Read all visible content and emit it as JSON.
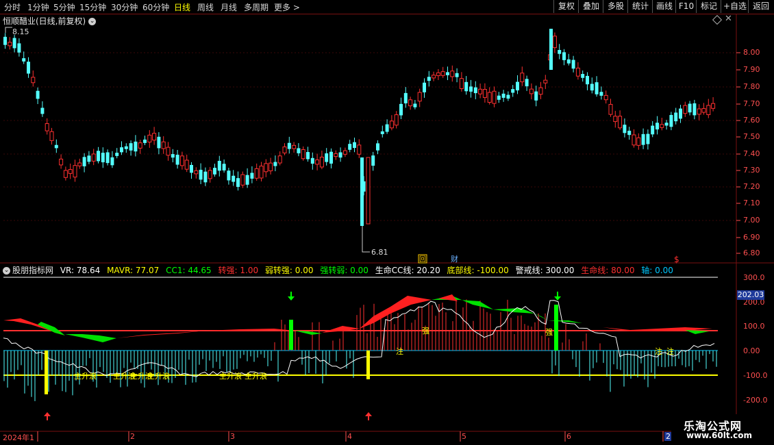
{
  "toolbar": {
    "timeframes": [
      "分时",
      "1分钟",
      "5分钟",
      "15分钟",
      "30分钟",
      "60分钟",
      "日线",
      "周线",
      "月线",
      "多周期",
      "更多 >"
    ],
    "active_timeframe": "日线",
    "right_buttons": [
      "复权",
      "叠加",
      "多股",
      "统计",
      "画线",
      "F10",
      "标记",
      "+自选",
      "返回"
    ]
  },
  "chart_title": "恒顺醋业(日线,前复权)",
  "price_axis": [
    "8.00",
    "7.90",
    "7.80",
    "7.70",
    "7.60",
    "7.50",
    "7.40",
    "7.30",
    "7.20",
    "7.10",
    "7.00",
    "6.90",
    "6.80"
  ],
  "high_label": "8.15",
  "low_label": "6.81",
  "markers": {
    "hui": "回",
    "cai": "财",
    "dollar": "$"
  },
  "indicator": {
    "name": "股朋指标网",
    "items": [
      {
        "text": "VR: 78.64",
        "color": "#ffffff"
      },
      {
        "text": "MAVR: 77.07",
        "color": "#ffff00"
      },
      {
        "text": "CC1: 44.65",
        "color": "#00ff00"
      },
      {
        "text": "转强: 1.00",
        "color": "#ff3030"
      },
      {
        "text": "弱转强: 0.00",
        "color": "#ffff00"
      },
      {
        "text": "强转弱: 0.00",
        "color": "#00ff00"
      },
      {
        "text": "生命CC线: 20.20",
        "color": "#ffffff"
      },
      {
        "text": "底部线: -100.00",
        "color": "#ffff00"
      },
      {
        "text": "警戒线: 300.00",
        "color": "#ffffff"
      },
      {
        "text": "生命线: 80.00",
        "color": "#ff3030"
      },
      {
        "text": "轴: 0.00",
        "color": "#00c8ff"
      }
    ],
    "axis": [
      "300.0",
      "200.0",
      "100.0",
      "0.00",
      "-100.0",
      "-200.0"
    ],
    "current_value": "202.03",
    "annotations": [
      "主升浪",
      "主升浪",
      "主升浪",
      "主升浪",
      "主升浪",
      "主升浪",
      "强",
      "强",
      "注",
      "注",
      "注"
    ]
  },
  "date_axis": [
    "2024年1",
    "2",
    "3",
    "4",
    "5",
    "6",
    "2"
  ],
  "watermark": {
    "line1": "乐淘公式网",
    "line2": "www.60lt.com"
  }
}
